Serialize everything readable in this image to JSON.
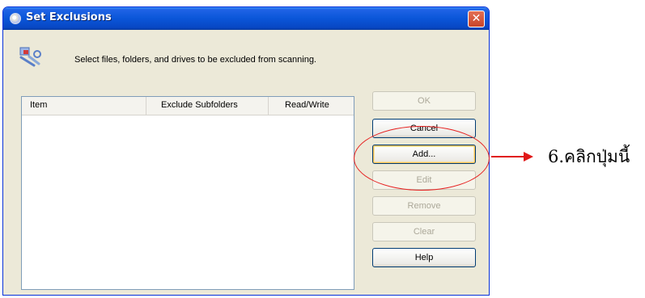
{
  "window": {
    "title": "Set Exclusions",
    "instruction": "Select files, folders, and drives to be excluded from scanning.",
    "close_glyph": "✕"
  },
  "list": {
    "columns": [
      "Item",
      "Exclude Subfolders",
      "Read/Write"
    ],
    "rows": []
  },
  "buttons": {
    "ok": {
      "label": "OK",
      "enabled": false
    },
    "cancel": {
      "label": "Cancel",
      "enabled": true
    },
    "add": {
      "label": "Add...",
      "enabled": true
    },
    "edit": {
      "label": "Edit",
      "enabled": false
    },
    "remove": {
      "label": "Remove",
      "enabled": false
    },
    "clear": {
      "label": "Clear",
      "enabled": false
    },
    "help": {
      "label": "Help",
      "enabled": true
    }
  },
  "annotation": {
    "text": "6.คลิกปุ่มนี้",
    "color": "#e01818"
  },
  "icons": {
    "app": "shield-app-icon",
    "header": "tools-icon",
    "close": "close-icon"
  }
}
